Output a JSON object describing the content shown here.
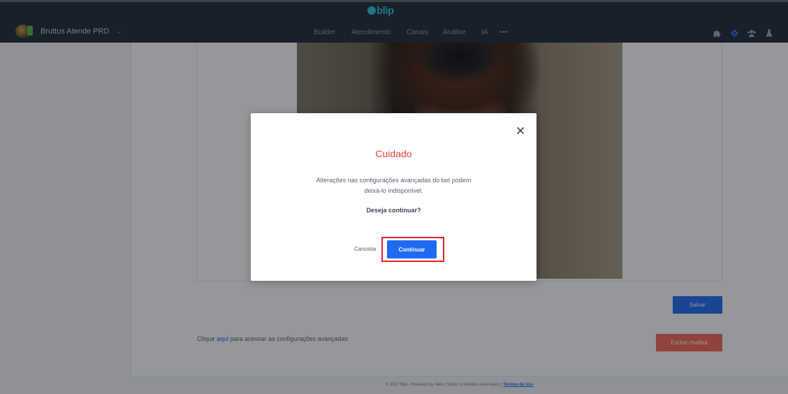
{
  "header": {
    "logo_text": "blip",
    "bot_name": "Bruttus Atende PRD",
    "nav": [
      "Builder",
      "Atendimento",
      "Canais",
      "Análise",
      "IA"
    ],
    "more": "•••",
    "icons": [
      "puzzle-icon",
      "gear-icon",
      "team-icon",
      "flask-icon"
    ]
  },
  "page": {
    "save_label": "Salvar",
    "advanced_prefix": "Clique ",
    "advanced_link": "aqui",
    "advanced_suffix": " para acessar as configurações avançadas",
    "delete_label": "Excluir chatbot",
    "footer_text": "© 2022 Blip - Powered by Take | Todos os direitos reservados | ",
    "footer_link": "Termos de Uso"
  },
  "modal": {
    "title": "Cuidado",
    "text_line1": "Alterações nas configurações avançadas do bot podem",
    "text_line2": "deixá-lo indisponível.",
    "question": "Deseja continuar?",
    "cancel_label": "Cancelar",
    "continue_label": "Continuar"
  },
  "colors": {
    "header_bg": "#1c2734",
    "primary": "#1e6bf1",
    "danger": "#f76556",
    "warning_title": "#ec3c3c",
    "highlight_border": "#e2202a"
  }
}
